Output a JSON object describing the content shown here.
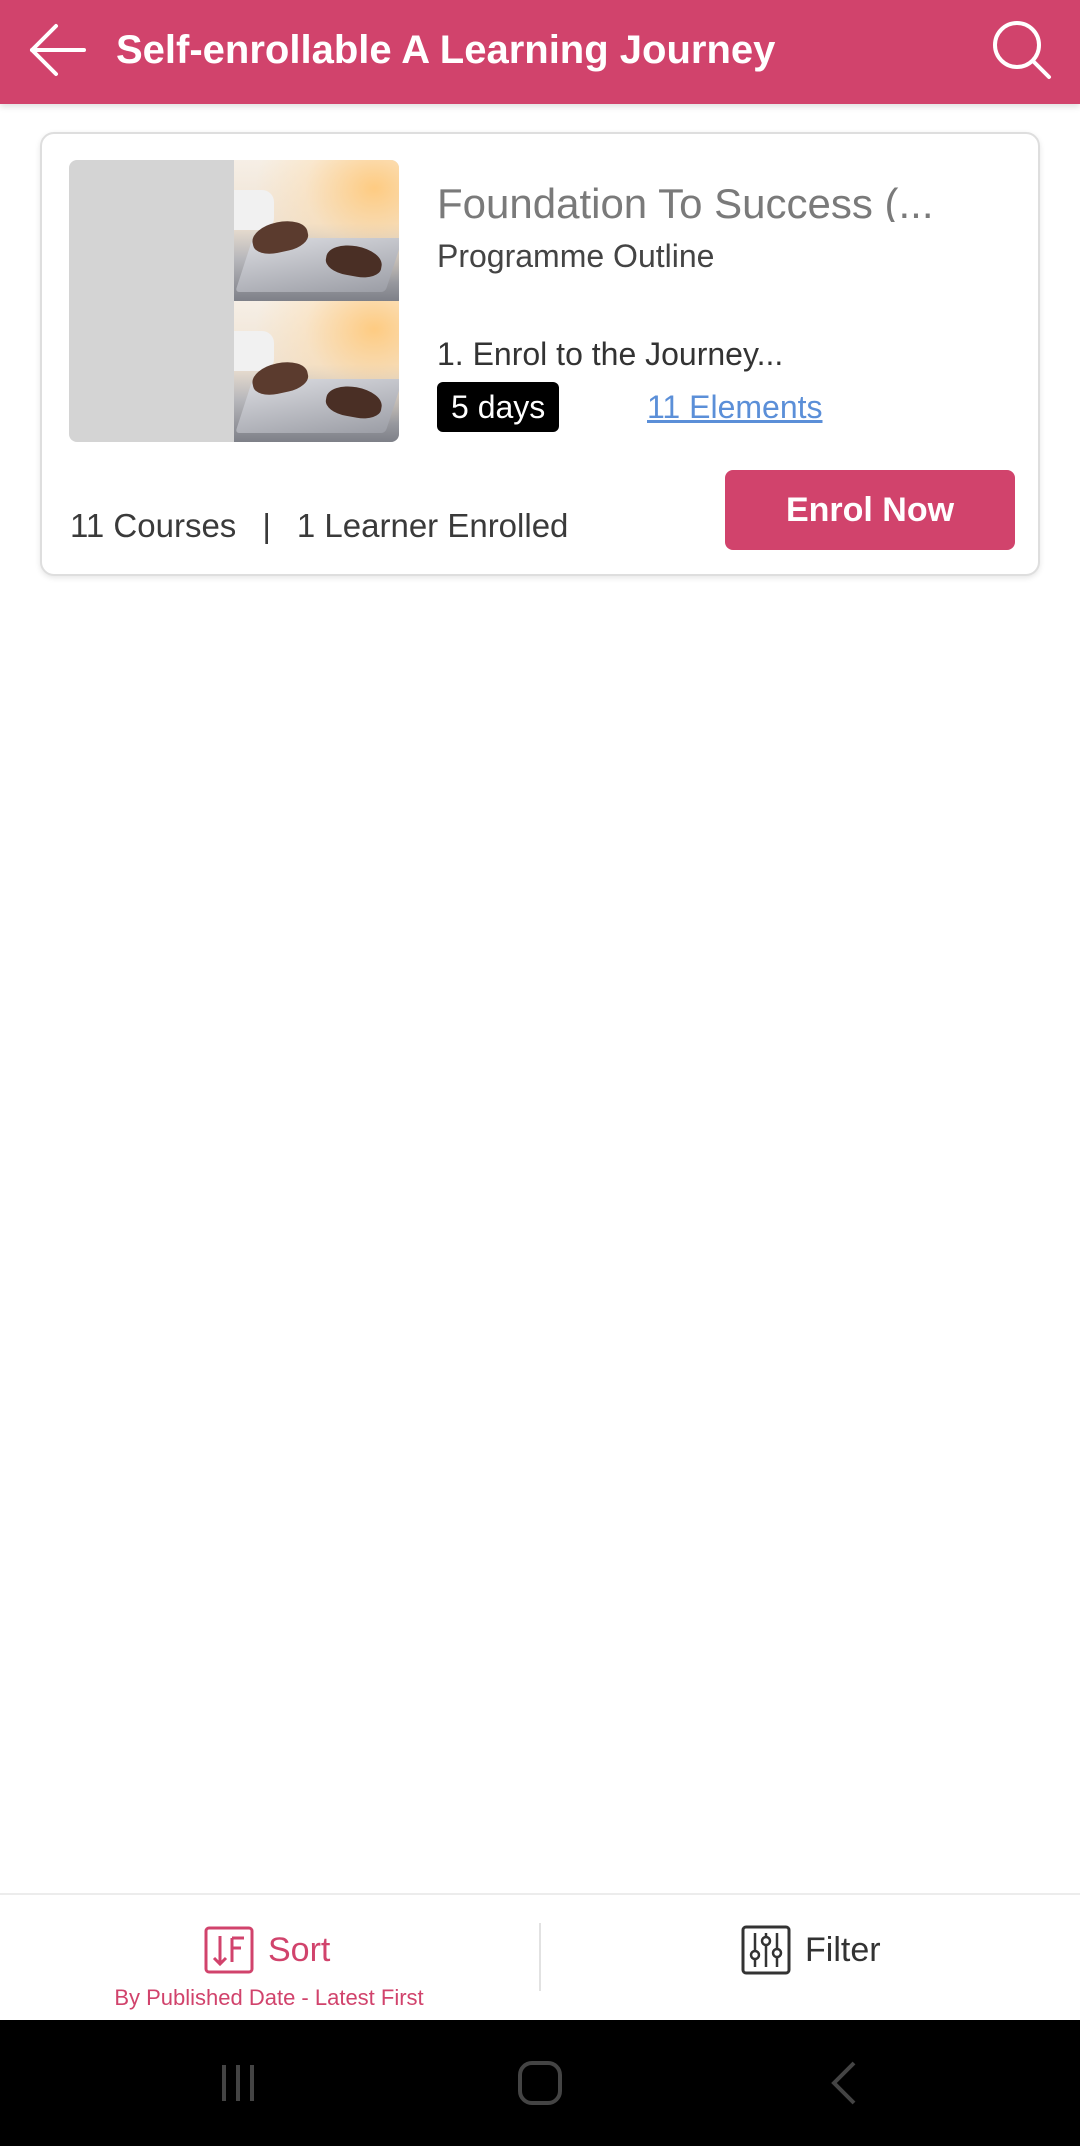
{
  "header": {
    "title": "Self-enrollable A Learning Journey",
    "back_icon": "arrow-left-icon",
    "search_icon": "search-icon",
    "background_color": "#d1436c"
  },
  "card": {
    "title": "Foundation To Success (...",
    "subtitle": "Programme Outline",
    "outline_item": "1. Enrol to the Journey...",
    "duration": "5 days",
    "elements_link": "11 Elements",
    "courses": "11 Courses",
    "separator": "|",
    "learners": "1 Learner Enrolled",
    "enrol_button": "Enrol Now"
  },
  "bottom_bar": {
    "sort_label": "Sort",
    "sort_subtitle": "By Published Date - Latest First",
    "filter_label": "Filter",
    "accent_color": "#d1436c"
  },
  "system_nav": {
    "recents_icon": "recents-icon",
    "home_icon": "home-icon",
    "back_icon": "nav-back-icon"
  }
}
